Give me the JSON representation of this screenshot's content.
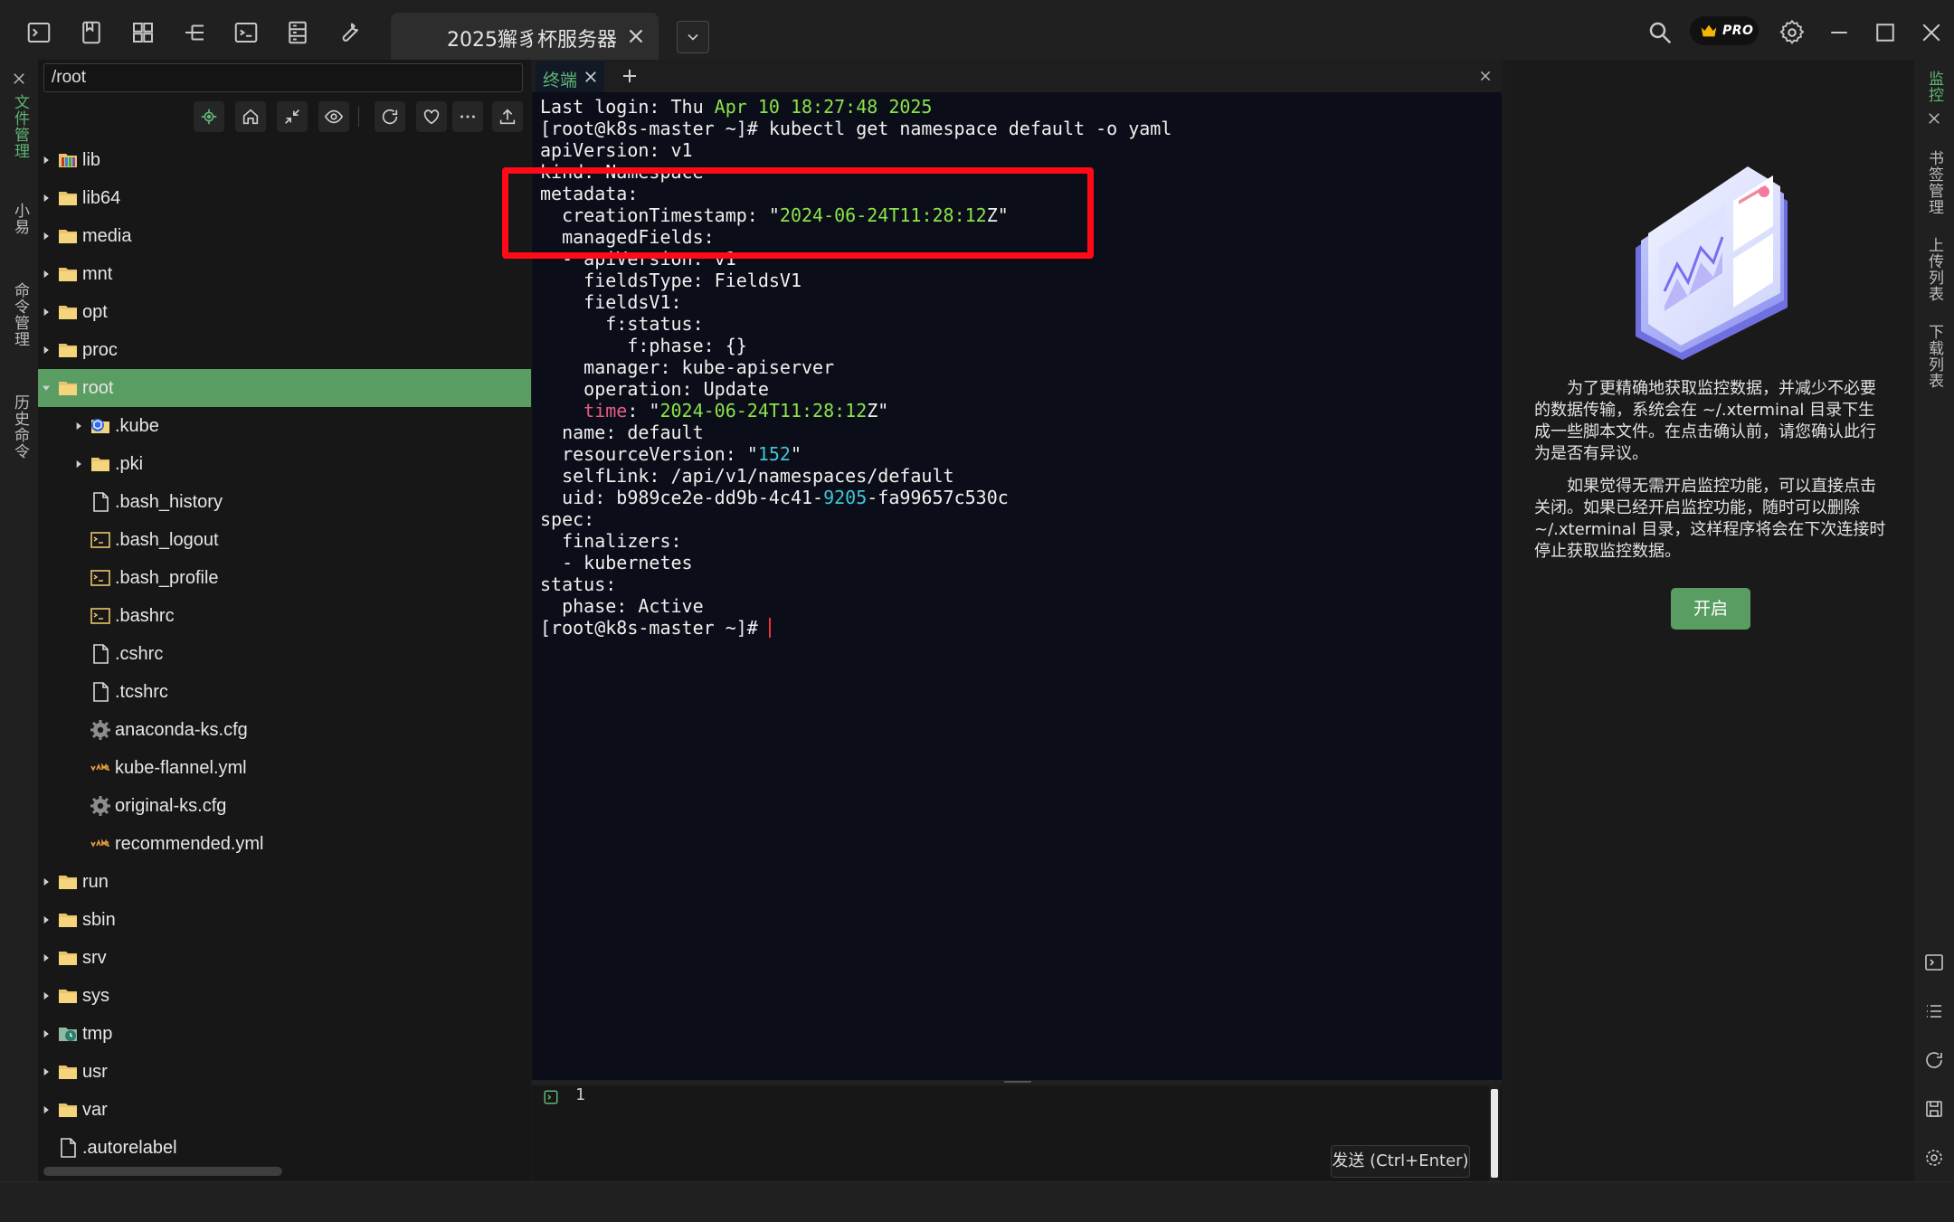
{
  "app": {
    "session_tab_title": "2025獬豸杯服务器",
    "pro_badge": "PRO"
  },
  "left_sidebar": {
    "tabs": [
      {
        "label": "文件管理",
        "active": true
      },
      {
        "label": "小易",
        "active": false
      },
      {
        "label": "命令管理",
        "active": false
      },
      {
        "label": "历史命令",
        "active": false
      }
    ]
  },
  "file_panel": {
    "path": "/root",
    "toolbar": [
      "locate-icon",
      "home-icon",
      "collapse-icon",
      "eye-icon",
      "refresh-icon",
      "heart-icon",
      "more-icon",
      "upload-icon"
    ],
    "tree": [
      {
        "name": "lib",
        "icon": "folder-lib",
        "level": 0,
        "expandable": true,
        "expanded": false
      },
      {
        "name": "lib64",
        "icon": "folder",
        "level": 0,
        "expandable": true,
        "expanded": false
      },
      {
        "name": "media",
        "icon": "folder",
        "level": 0,
        "expandable": true,
        "expanded": false
      },
      {
        "name": "mnt",
        "icon": "folder",
        "level": 0,
        "expandable": true,
        "expanded": false
      },
      {
        "name": "opt",
        "icon": "folder",
        "level": 0,
        "expandable": true,
        "expanded": false
      },
      {
        "name": "proc",
        "icon": "folder",
        "level": 0,
        "expandable": true,
        "expanded": false
      },
      {
        "name": "root",
        "icon": "folder",
        "level": 0,
        "expandable": true,
        "expanded": true,
        "selected": true
      },
      {
        "name": ".kube",
        "icon": "folder-kube",
        "level": 1,
        "expandable": true,
        "expanded": false
      },
      {
        "name": ".pki",
        "icon": "folder",
        "level": 1,
        "expandable": true,
        "expanded": false
      },
      {
        "name": ".bash_history",
        "icon": "file",
        "level": 1
      },
      {
        "name": ".bash_logout",
        "icon": "script",
        "level": 1
      },
      {
        "name": ".bash_profile",
        "icon": "script",
        "level": 1
      },
      {
        "name": ".bashrc",
        "icon": "script",
        "level": 1
      },
      {
        "name": ".cshrc",
        "icon": "file",
        "level": 1
      },
      {
        "name": ".tcshrc",
        "icon": "file",
        "level": 1
      },
      {
        "name": "anaconda-ks.cfg",
        "icon": "gear",
        "level": 1
      },
      {
        "name": "kube-flannel.yml",
        "icon": "yaml",
        "level": 1
      },
      {
        "name": "original-ks.cfg",
        "icon": "gear",
        "level": 1
      },
      {
        "name": "recommended.yml",
        "icon": "yaml",
        "level": 1
      },
      {
        "name": "run",
        "icon": "folder",
        "level": 0,
        "expandable": true,
        "expanded": false
      },
      {
        "name": "sbin",
        "icon": "folder",
        "level": 0,
        "expandable": true,
        "expanded": false
      },
      {
        "name": "srv",
        "icon": "folder",
        "level": 0,
        "expandable": true,
        "expanded": false
      },
      {
        "name": "sys",
        "icon": "folder",
        "level": 0,
        "expandable": true,
        "expanded": false
      },
      {
        "name": "tmp",
        "icon": "folder-tmp",
        "level": 0,
        "expandable": true,
        "expanded": false
      },
      {
        "name": "usr",
        "icon": "folder",
        "level": 0,
        "expandable": true,
        "expanded": false
      },
      {
        "name": "var",
        "icon": "folder",
        "level": 0,
        "expandable": true,
        "expanded": false
      },
      {
        "name": ".autorelabel",
        "icon": "file",
        "level": 0
      }
    ]
  },
  "terminal": {
    "tab_label": "终端",
    "lines": [
      [
        {
          "t": "Last login: Thu "
        },
        {
          "t": "Apr 10 18:27:48 2025",
          "c": "g"
        }
      ],
      [
        {
          "t": "[root@k8s-master ~]# kubectl get namespace default -o yaml"
        }
      ],
      [
        {
          "t": "apiVersion: v1"
        }
      ],
      [
        {
          "t": "kind: Namespace"
        }
      ],
      [
        {
          "t": "metadata:"
        }
      ],
      [
        {
          "t": "  creationTimestamp: \""
        },
        {
          "t": "2024-06-24T11:28:12",
          "c": "g"
        },
        {
          "t": "Z\""
        }
      ],
      [
        {
          "t": "  managedFields:"
        }
      ],
      [
        {
          "t": "  - apiVersion: v1"
        }
      ],
      [
        {
          "t": "    fieldsType: FieldsV1"
        }
      ],
      [
        {
          "t": "    fieldsV1:"
        }
      ],
      [
        {
          "t": "      f:status:"
        }
      ],
      [
        {
          "t": "        f:phase: {}"
        }
      ],
      [
        {
          "t": "    manager: kube-apiserver"
        }
      ],
      [
        {
          "t": "    operation: Update"
        }
      ],
      [
        {
          "t": "    "
        },
        {
          "t": "time",
          "c": "r"
        },
        {
          "t": ": \""
        },
        {
          "t": "2024-06-24T11:28:12",
          "c": "g"
        },
        {
          "t": "Z\""
        }
      ],
      [
        {
          "t": "  name: default"
        }
      ],
      [
        {
          "t": "  resourceVersion: \""
        },
        {
          "t": "152",
          "c": "c"
        },
        {
          "t": "\""
        }
      ],
      [
        {
          "t": "  selfLink: /api/v1/namespaces/default"
        }
      ],
      [
        {
          "t": "  uid: b989ce2e-dd9b-4c41-"
        },
        {
          "t": "9205",
          "c": "c"
        },
        {
          "t": "-fa99657c530c"
        }
      ],
      [
        {
          "t": "spec:"
        }
      ],
      [
        {
          "t": "  finalizers:"
        }
      ],
      [
        {
          "t": "  - kubernetes"
        }
      ],
      [
        {
          "t": "status:"
        }
      ],
      [
        {
          "t": "  phase: Active"
        }
      ],
      [
        {
          "t": "[root@k8s-master ~]# "
        }
      ]
    ]
  },
  "command_panel": {
    "line_number": "1",
    "send_button": "发送 (Ctrl+Enter)"
  },
  "monitor_panel": {
    "paragraphs": [
      "为了更精确地获取监控数据，并减少不必要的数据传输，系统会在 ~/.xterminal 目录下生成一些脚本文件。在点击确认前，请您确认此行为是否有异议。",
      "如果觉得无需开启监控功能，可以直接点击关闭。如果已经开启监控功能，随时可以删除 ~/.xterminal 目录，这样程序将会在下次连接时停止获取监控数据。"
    ],
    "enable_button": "开启"
  },
  "right_sidebar": {
    "tabs": [
      {
        "label": "监控",
        "active": true
      },
      {
        "label": "书签管理",
        "active": false
      },
      {
        "label": "上传列表",
        "active": false
      },
      {
        "label": "下载列表",
        "active": false
      }
    ]
  },
  "colors": {
    "accent_green": "#5a9d63",
    "highlight_red": "#ff0a16",
    "terminal_bg": "#0b0e18"
  }
}
